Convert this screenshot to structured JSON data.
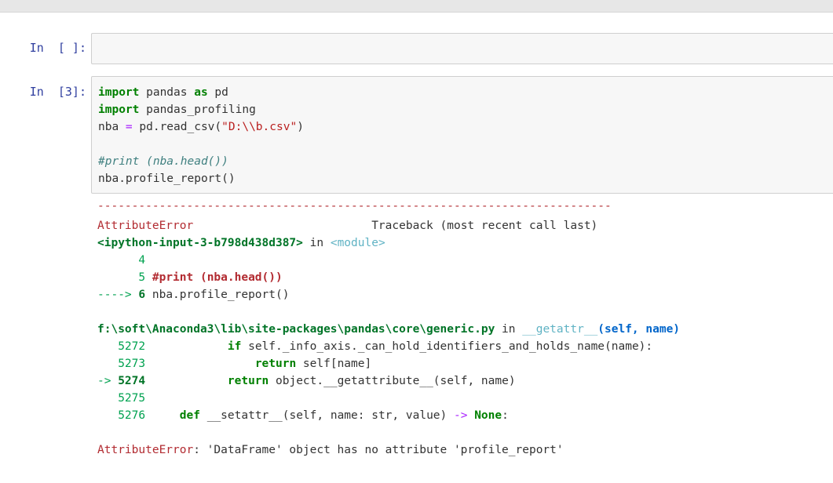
{
  "cells": [
    {
      "prompt": "In  [ ]:",
      "code": []
    },
    {
      "prompt": "In  [3]:",
      "code": [
        "import pandas as pd",
        "import pandas_profiling",
        "nba = pd.read_csv(\"D:\\\\b.csv\")",
        "",
        "#print (nba.head())",
        "nba.profile_report()"
      ]
    }
  ],
  "output": {
    "separator": "---------------------------------------------------------------------------",
    "error_name": "AttributeError",
    "traceback_header": "Traceback (most recent call last)",
    "input_ref": "<ipython-input-3-b798d438d387>",
    "in_word": "in",
    "module_ref": "<module>",
    "frame1": [
      {
        "num": "4",
        "text": ""
      },
      {
        "num": "5",
        "text": "#print (nba.head())"
      },
      {
        "arrow": "---->",
        "num": "6",
        "text": "nba.profile_report()"
      }
    ],
    "file_path": "f:\\soft\\Anaconda3\\lib\\site-packages\\pandas\\core\\generic.py",
    "func": "__getattr__",
    "func_args": "(self, name)",
    "frame2": [
      {
        "num": "5272",
        "text": "if self._info_axis._can_hold_identifiers_and_holds_name(name):"
      },
      {
        "num": "5273",
        "text": "return self[name]"
      },
      {
        "arrow": "->",
        "num": "5274",
        "text": "return object.__getattribute__(self, name)"
      },
      {
        "num": "5275",
        "text": ""
      },
      {
        "num": "5276",
        "text": "def __setattr__(self, name: str, value) -> None:"
      }
    ],
    "final_error_name": "AttributeError",
    "final_error_msg": ": 'DataFrame' object has no attribute 'profile_report'"
  }
}
